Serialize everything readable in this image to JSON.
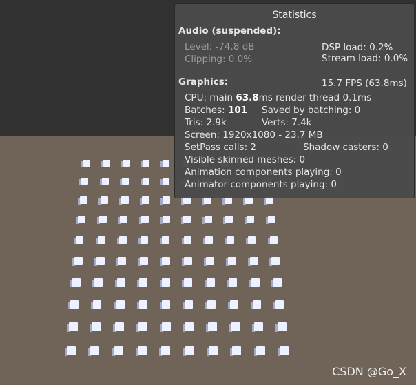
{
  "stats": {
    "title": "Statistics",
    "audio_header": "Audio (suspended):",
    "level": "Level: -74.8 dB",
    "clipping": "Clipping: 0.0%",
    "dsp_load": "DSP load: 0.2%",
    "stream_load": "Stream load: 0.0%",
    "graphics_header": "Graphics:",
    "fps": "15.7 FPS (63.8ms)",
    "cpu_prefix": "CPU: main ",
    "cpu_main": "63.8",
    "cpu_suffix": "ms  render thread 0.1ms",
    "batches_prefix": "Batches: ",
    "batches_value": "101",
    "saved_by_batching": "Saved by batching: 0",
    "tris": "Tris: 2.9k",
    "verts": "Verts: 7.4k",
    "screen": "Screen: 1920x1080 - 23.7 MB",
    "setpass": "SetPass calls: 2",
    "shadow_casters": "Shadow casters: 0",
    "visible_skinned": "Visible skinned meshes: 0",
    "animation_components": "Animation components playing: 0",
    "animator_components": "Animator components playing: 0"
  },
  "watermark": "CSDN @Go_X",
  "colors": {
    "sky": "#313131",
    "ground": "#706358",
    "cube_face": "#eef1ff",
    "panel_bg": "#4a4a4a"
  },
  "scene": {
    "cube_grid_rows": 10,
    "cube_grid_cols": 10
  }
}
